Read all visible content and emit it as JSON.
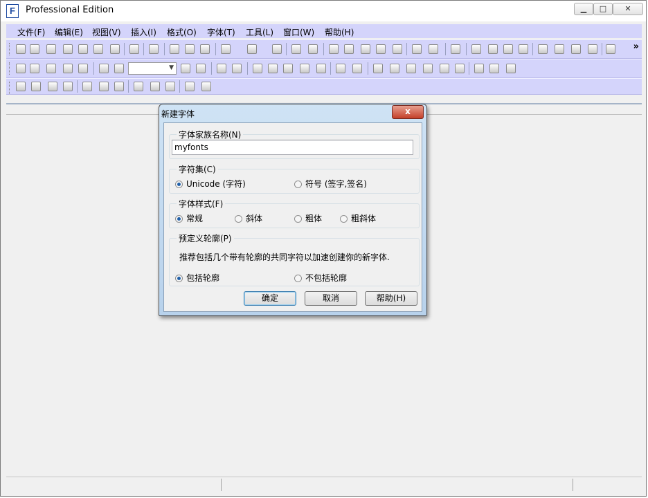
{
  "window": {
    "title": "Professional Edition",
    "app_icon_glyph": "F",
    "controls": [
      "minimize-icon",
      "maximize-icon",
      "close-icon"
    ]
  },
  "menu": [
    {
      "label": "文件(F)"
    },
    {
      "label": "编辑(E)"
    },
    {
      "label": "视图(V)"
    },
    {
      "label": "插入(I)"
    },
    {
      "label": "格式(O)"
    },
    {
      "label": "字体(T)"
    },
    {
      "label": "工具(L)"
    },
    {
      "label": "窗口(W)"
    },
    {
      "label": "帮助(H)"
    }
  ],
  "toolbar": {
    "overflow_label": "»",
    "zoom_combo_value": ""
  },
  "dialog": {
    "title": "新建字体",
    "close_label": "x",
    "family": {
      "legend": "字体家族名称(N)",
      "value": "myfonts"
    },
    "charset": {
      "legend": "字符集(C)",
      "options": [
        {
          "label": "Unicode (字符)",
          "selected": true
        },
        {
          "label": "符号 (签字,签名)",
          "selected": false
        }
      ]
    },
    "style": {
      "legend": "字体样式(F)",
      "options": [
        {
          "label": "常规",
          "selected": true
        },
        {
          "label": "斜体",
          "selected": false
        },
        {
          "label": "粗体",
          "selected": false
        },
        {
          "label": "粗斜体",
          "selected": false
        }
      ]
    },
    "outline": {
      "legend": "预定义轮廓(P)",
      "description": "推荐包括几个带有轮廓的共同字符以加速创建你的新字体.",
      "options": [
        {
          "label": "包括轮廓",
          "selected": true
        },
        {
          "label": "不包括轮廓",
          "selected": false
        }
      ]
    },
    "buttons": {
      "ok": "确定",
      "cancel": "取消",
      "help": "帮助(H)"
    }
  },
  "colors": {
    "toolbar_bg": "#d4d4fb",
    "radio_selected": "#1f5fa8",
    "close_button": "#c4402a"
  }
}
